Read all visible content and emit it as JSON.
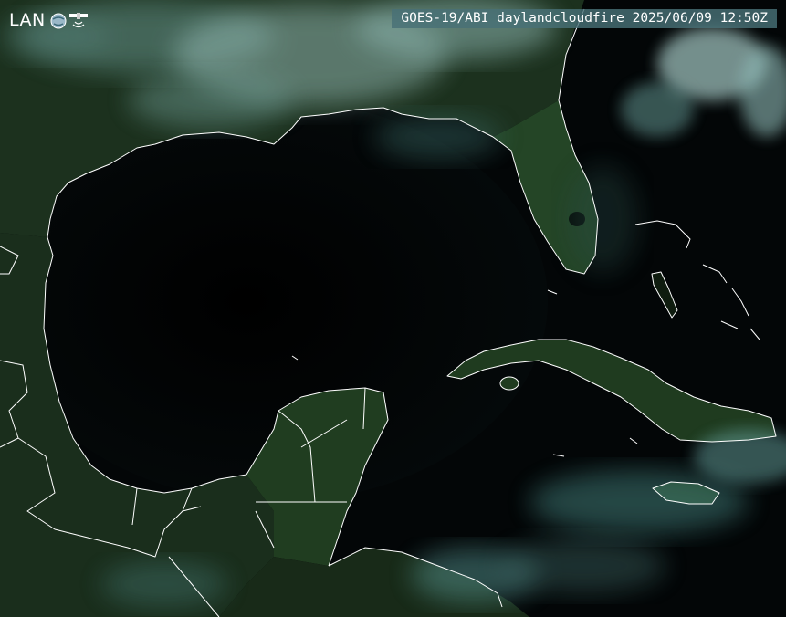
{
  "header": {
    "logo_text": "LAN",
    "logo_icon": "satellite-icon",
    "title": "GOES-19/ABI daylandcloudfire 2025/06/09 12:50Z"
  },
  "colors": {
    "ocean": "#020405",
    "land": "#1e3a1e",
    "cloud": "#6fb8b4",
    "coastline": "#ffffff",
    "banner": "#487076"
  }
}
